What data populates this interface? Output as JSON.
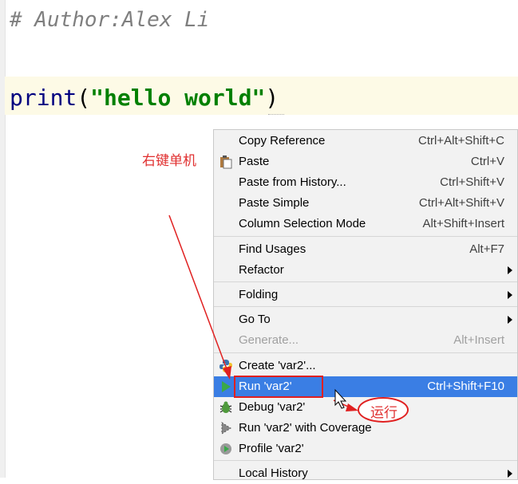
{
  "editor": {
    "comment_line": "# Author:Alex Li",
    "code": {
      "func": "print",
      "open": "(",
      "string": "\"hello world\"",
      "close": ")"
    }
  },
  "context_menu": {
    "items": [
      {
        "label": "Copy Reference",
        "shortcut": "Ctrl+Alt+Shift+C"
      },
      {
        "label": "Paste",
        "shortcut": "Ctrl+V",
        "icon": "clipboard-icon"
      },
      {
        "label": "Paste from History...",
        "shortcut": "Ctrl+Shift+V"
      },
      {
        "label": "Paste Simple",
        "shortcut": "Ctrl+Alt+Shift+V"
      },
      {
        "label": "Column Selection Mode",
        "shortcut": "Alt+Shift+Insert"
      },
      {
        "label": "Find Usages",
        "shortcut": "Alt+F7"
      },
      {
        "label": "Refactor",
        "shortcut": ""
      },
      {
        "label": "Folding",
        "shortcut": ""
      },
      {
        "label": "Go To",
        "shortcut": ""
      },
      {
        "label": "Generate...",
        "shortcut": "Alt+Insert"
      },
      {
        "label": "Create 'var2'...",
        "shortcut": "",
        "icon": "python-icon"
      },
      {
        "label": "Run 'var2'",
        "shortcut": "Ctrl+Shift+F10",
        "icon": "run-icon"
      },
      {
        "label": "Debug 'var2'",
        "shortcut": "",
        "icon": "debug-icon"
      },
      {
        "label": "Run 'var2' with Coverage",
        "shortcut": "",
        "icon": "coverage-icon"
      },
      {
        "label": "Profile 'var2'",
        "shortcut": "",
        "icon": "profile-icon"
      },
      {
        "label": "Local History",
        "shortcut": ""
      }
    ]
  },
  "annotations": {
    "right_click": "右键单机",
    "run": "运行"
  },
  "colors": {
    "selection": "#3a7ee4",
    "annotation_red": "#e02020",
    "run_green": "#3aa84a"
  }
}
